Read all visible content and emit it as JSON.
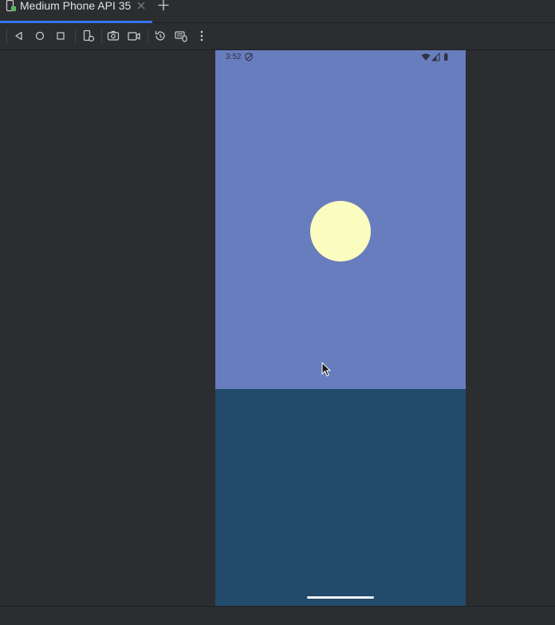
{
  "window": {
    "tab_label": "Medium Phone API 35",
    "accent_color": "#3574f0"
  },
  "toolbar": {
    "buttons": [
      {
        "name": "back-icon"
      },
      {
        "name": "home-icon"
      },
      {
        "name": "overview-icon"
      },
      {
        "name": "device-settings-icon"
      },
      {
        "name": "screenshot-icon"
      },
      {
        "name": "screen-record-icon"
      },
      {
        "name": "snapshot-icon"
      },
      {
        "name": "keyboard-mouse-icon"
      },
      {
        "name": "more-options-icon"
      }
    ]
  },
  "device": {
    "status_time": "3:52",
    "sky_color": "#687dbd",
    "sea_color": "#224b6b",
    "sun_color": "#fbfcbf"
  }
}
